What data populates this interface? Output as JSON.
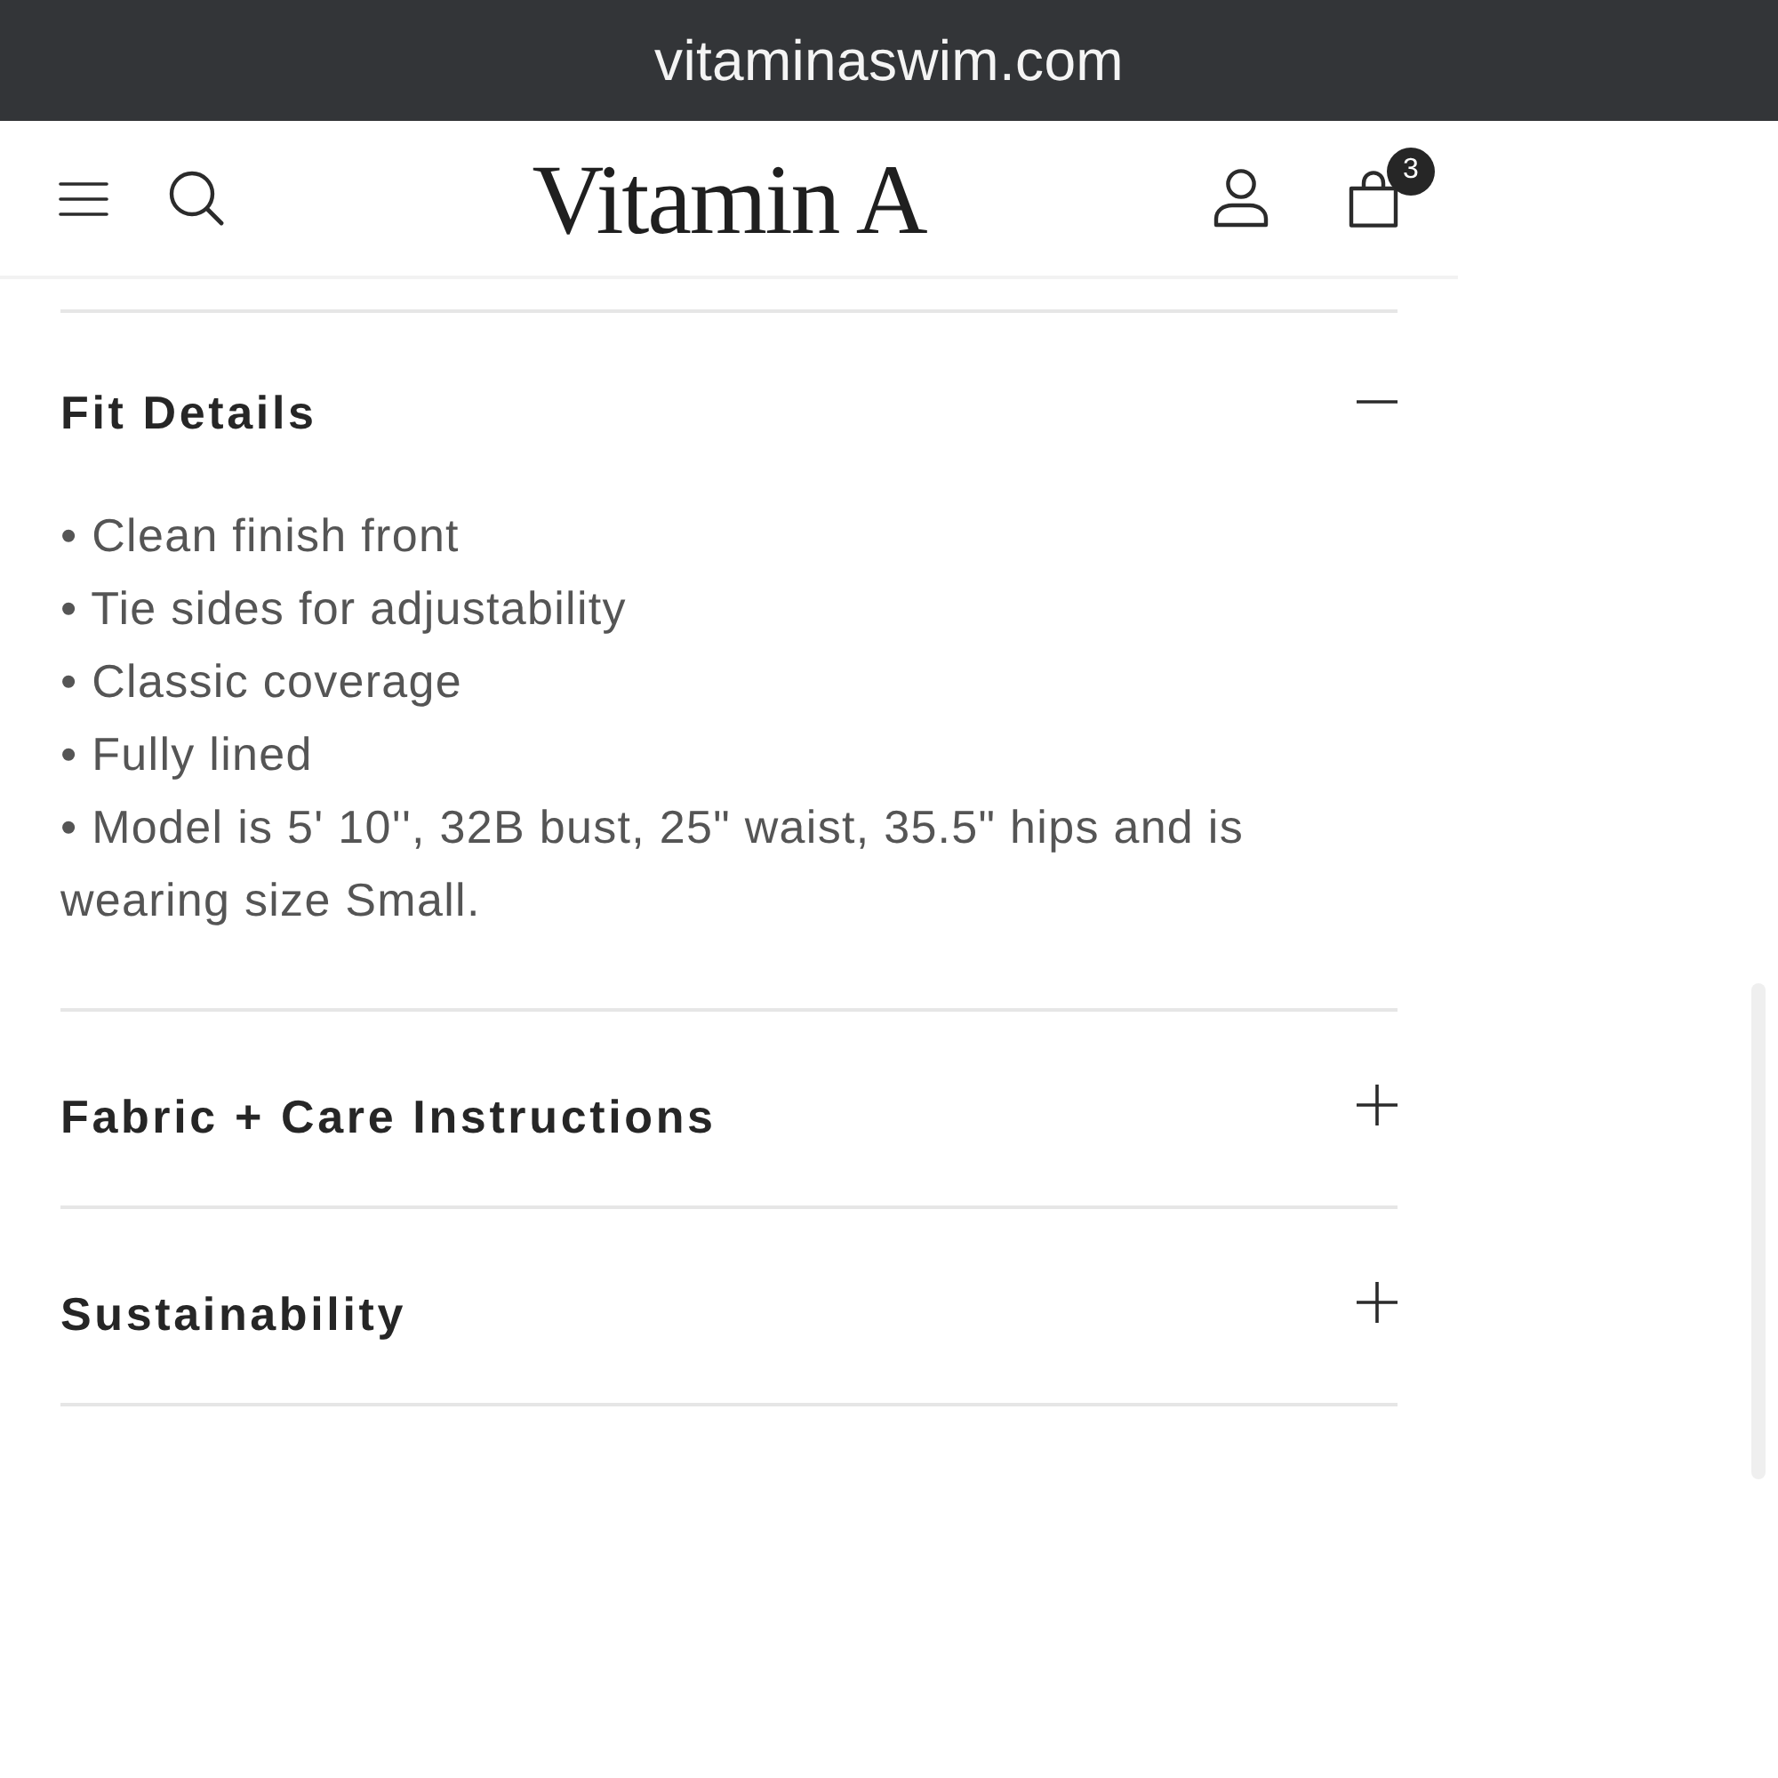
{
  "browser": {
    "url": "vitaminaswim.com"
  },
  "header": {
    "logo": "Vitamin A",
    "cart_count": "3"
  },
  "sections": [
    {
      "title": "Fit Details",
      "expanded": true,
      "bullets": [
        "• Clean finish front",
        "• Tie sides for adjustability",
        "• Classic coverage",
        "• Fully lined",
        "• Model is 5' 10'', 32B bust, 25\" waist, 35.5\" hips and is wearing size Small."
      ]
    },
    {
      "title": "Fabric + Care Instructions",
      "expanded": false
    },
    {
      "title": "Sustainability",
      "expanded": false
    }
  ]
}
